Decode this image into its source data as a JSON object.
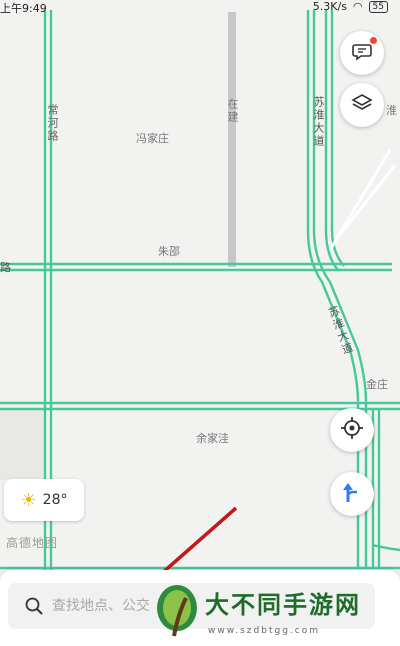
{
  "status_bar": {
    "time": "上午9:49",
    "speed": "5.3K/s",
    "battery": "55"
  },
  "map": {
    "labels": {
      "changhe_road": "常河路",
      "fengjiazhuang": "冯家庄",
      "zaijian": "在建",
      "suhuai_avenue_north": "苏淮大道",
      "zhuzhao": "朱邵",
      "road_fragment": "路",
      "suhuai_avenue_south": "苏淮大道",
      "jinzhuang": "金庄",
      "yujiawa": "余家洼",
      "edge_fragment": "淮"
    },
    "road_color": "#46c99a",
    "logo_text": "高德地图"
  },
  "weather": {
    "temperature": "28°",
    "icon": "sun-icon"
  },
  "buttons": {
    "message": "message-icon",
    "layers": "layers-icon",
    "locate": "locate-icon",
    "route": "route-icon"
  },
  "search": {
    "placeholder": "查找地点、公交"
  },
  "watermark": {
    "title": "大不同手游网",
    "url": "www.szdbtgg.com"
  }
}
